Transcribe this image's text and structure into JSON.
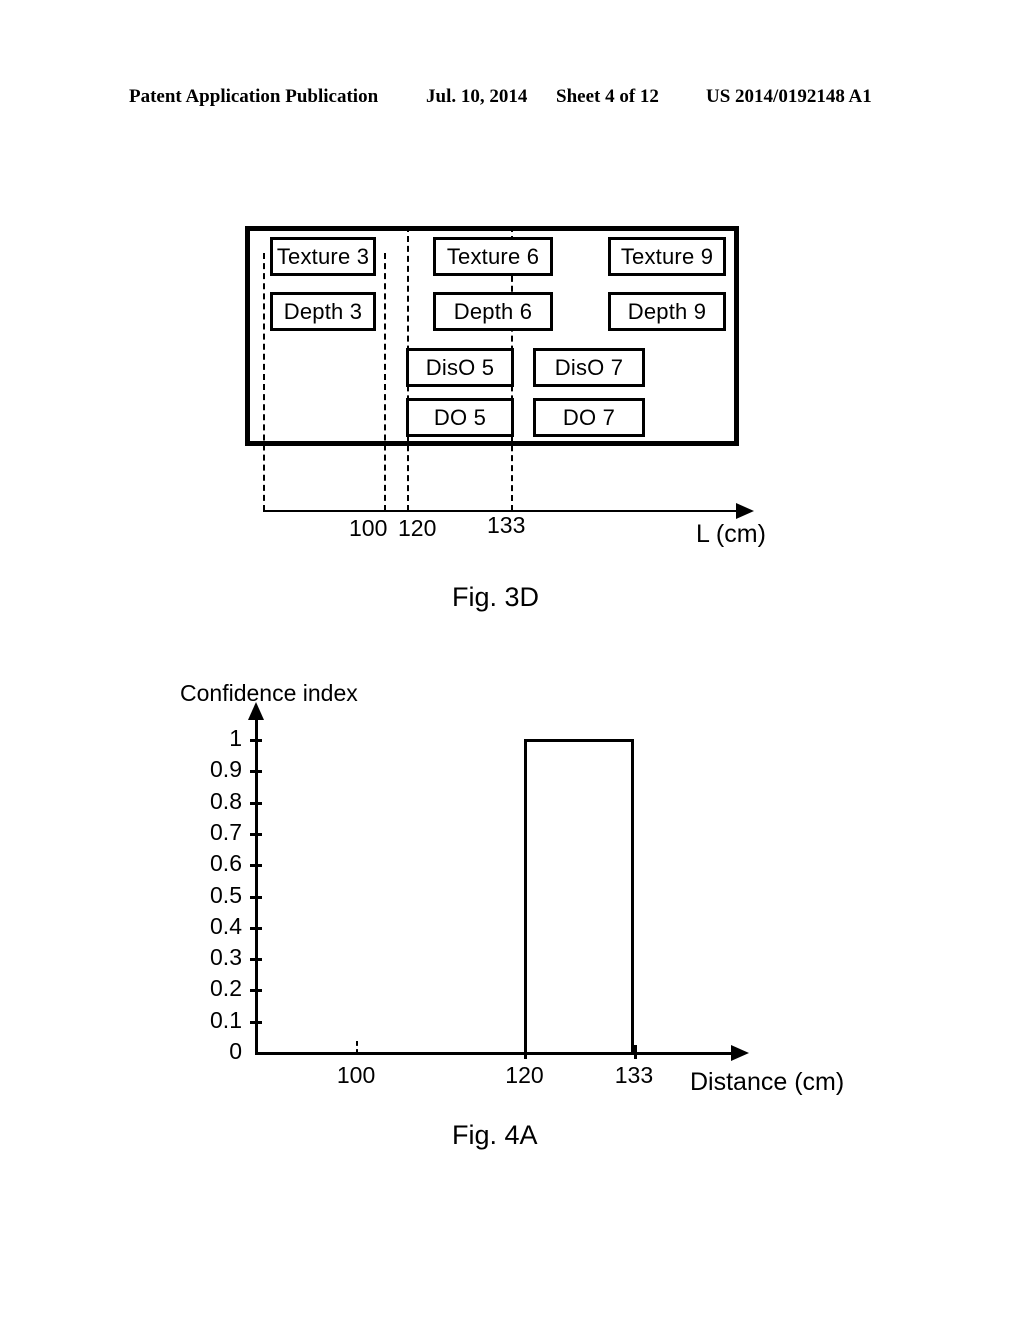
{
  "header": {
    "publication": "Patent Application Publication",
    "date": "Jul. 10, 2014",
    "sheet": "Sheet 4 of 12",
    "patent_number": "US 2014/0192148 A1"
  },
  "fig3d": {
    "caption": "Fig. 3D",
    "axis_title": "L (cm)",
    "axis_ticks": [
      "100",
      "120",
      "133"
    ],
    "boxes": [
      {
        "label": "Texture 3"
      },
      {
        "label": "Texture 6"
      },
      {
        "label": "Texture 9"
      },
      {
        "label": "Depth 3"
      },
      {
        "label": "Depth 6"
      },
      {
        "label": "Depth 9"
      },
      {
        "label": "DisO 5"
      },
      {
        "label": "DisO 7"
      },
      {
        "label": "DO 5"
      },
      {
        "label": "DO 7"
      }
    ]
  },
  "fig4a": {
    "caption": "Fig. 4A"
  },
  "chart_data": {
    "type": "bar",
    "title": "Fig. 4A",
    "xlabel": "Distance (cm)",
    "ylabel": "Confidence index",
    "xlim": [
      88,
      145
    ],
    "ylim": [
      0,
      1
    ],
    "grid": false,
    "legend": "none",
    "x_ticks": [
      "100",
      "120",
      "133"
    ],
    "x_tick_values": [
      100,
      120,
      133
    ],
    "y_ticks": [
      "0",
      "0.1",
      "0.2",
      "0.3",
      "0.4",
      "0.5",
      "0.6",
      "0.7",
      "0.8",
      "0.9",
      "1"
    ],
    "y_tick_values": [
      0,
      0.1,
      0.2,
      0.3,
      0.4,
      0.5,
      0.6,
      0.7,
      0.8,
      0.9,
      1
    ],
    "bars": [
      {
        "x_start": 120,
        "x_end": 133,
        "value": 1
      }
    ],
    "categories": [
      "100",
      "120-133"
    ],
    "values": [
      0,
      1
    ]
  }
}
